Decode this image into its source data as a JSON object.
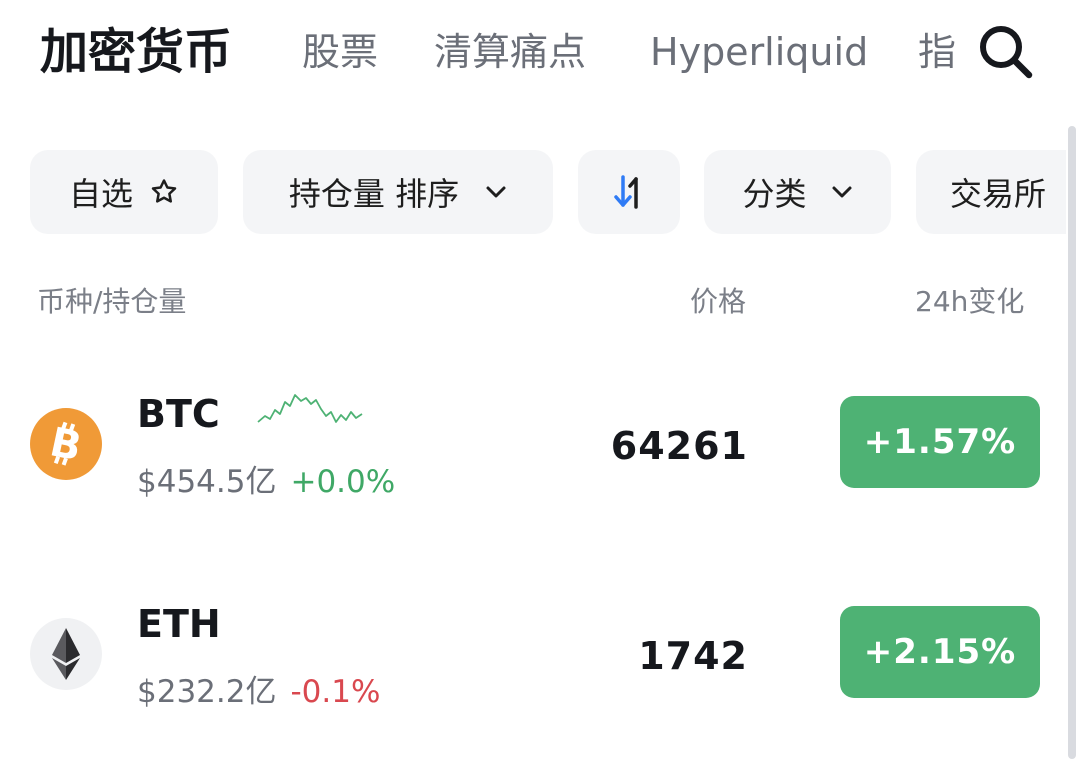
{
  "tabs": [
    {
      "label": "加密货币",
      "active": true
    },
    {
      "label": "股票"
    },
    {
      "label": "清算痛点"
    },
    {
      "label": "Hyperliquid"
    },
    {
      "label": "指"
    }
  ],
  "filters": {
    "watchlist": "自选",
    "sort_by": "持仓量 排序",
    "category": "分类",
    "exchange": "交易所"
  },
  "columns": {
    "coin": "币种/持仓量",
    "price": "价格",
    "change": "24h变化"
  },
  "rows": [
    {
      "symbol": "BTC",
      "open_interest": "$454.5亿",
      "oi_change": "+0.0%",
      "oi_trend": "up",
      "price": "64261",
      "change_24h": "+1.57%",
      "icon": "bitcoin-icon",
      "icon_color": "#f09a37"
    },
    {
      "symbol": "ETH",
      "open_interest": "$232.2亿",
      "oi_change": "-0.1%",
      "oi_trend": "down",
      "price": "1742",
      "change_24h": "+2.15%",
      "icon": "ethereum-icon",
      "icon_color": "#f0f1f3"
    }
  ],
  "colors": {
    "positive": "#4eb274",
    "positive_text": "#3fa866",
    "negative": "#d9484f",
    "sort_arrow": "#2f7bf5"
  }
}
